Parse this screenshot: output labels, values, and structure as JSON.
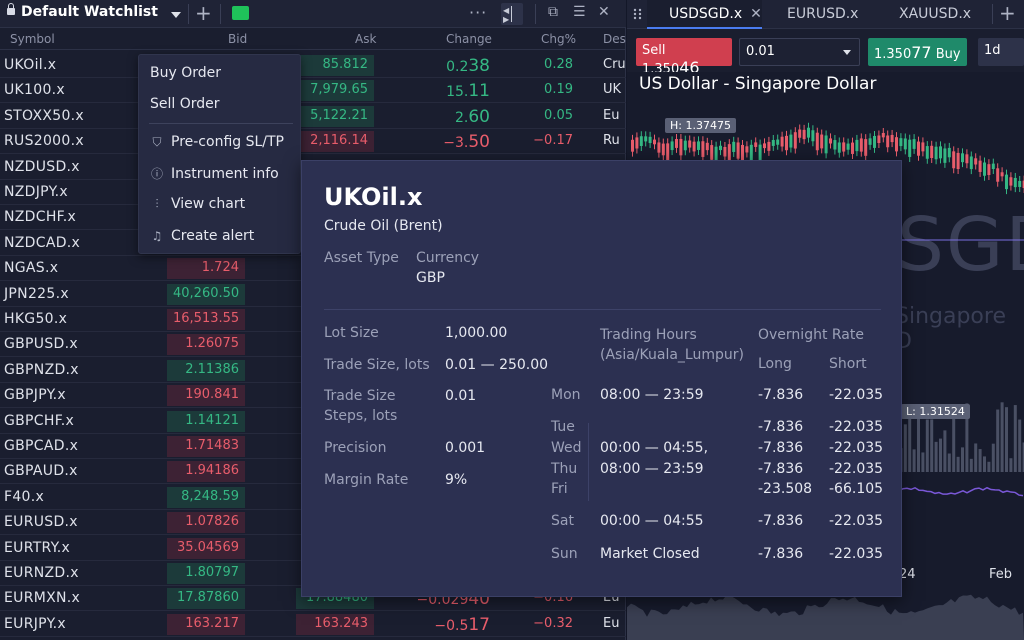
{
  "watchlist": {
    "title": "Default Watchlist",
    "columns": {
      "symbol": "Symbol",
      "bid": "Bid",
      "ask": "Ask",
      "change": "Change",
      "chg_pct": "Chg%",
      "desc": "Des"
    },
    "rows": [
      {
        "symbol": "UKOil.x",
        "bid": "",
        "ask": "85.812",
        "chg_main": "0.2",
        "chg_big": "38",
        "chg_pct": "0.28",
        "desc": "Cru",
        "dir": "up"
      },
      {
        "symbol": "UK100.x",
        "bid": "",
        "ask": "7,979.65",
        "chg_main": "15.",
        "chg_big": "11",
        "chg_pct": "0.19",
        "desc": "UK",
        "dir": "up"
      },
      {
        "symbol": "STOXX50.x",
        "bid": "",
        "ask": "5,122.21",
        "chg_main": "2.",
        "chg_big": "60",
        "chg_pct": "0.05",
        "desc": "Eu",
        "dir": "up"
      },
      {
        "symbol": "RUS2000.x",
        "bid": "",
        "ask": "2,116.14",
        "chg_main": "−3.",
        "chg_big": "50",
        "chg_pct": "−0.17",
        "desc": "Ru",
        "dir": "dn"
      },
      {
        "symbol": "NZDUSD.x",
        "bid": "",
        "ask": "",
        "chg_main": "",
        "chg_big": "",
        "chg_pct": "",
        "desc": "",
        "dir": "up"
      },
      {
        "symbol": "NZDJPY.x",
        "bid": "",
        "ask": "",
        "chg_main": "",
        "chg_big": "",
        "chg_pct": "",
        "desc": "",
        "dir": "up"
      },
      {
        "symbol": "NZDCHF.x",
        "bid": "",
        "ask": "",
        "chg_main": "",
        "chg_big": "",
        "chg_pct": "",
        "desc": "",
        "dir": "up"
      },
      {
        "symbol": "NZDCAD.x",
        "bid": "",
        "ask": "",
        "chg_main": "",
        "chg_big": "",
        "chg_pct": "",
        "desc": "",
        "dir": "up"
      },
      {
        "symbol": "NGAS.x",
        "bid": "1.724",
        "ask": "",
        "chg_main": "",
        "chg_big": "",
        "chg_pct": "",
        "desc": "",
        "dir": "dn"
      },
      {
        "symbol": "JPN225.x",
        "bid": "40,260.50",
        "ask": "",
        "chg_main": "",
        "chg_big": "",
        "chg_pct": "",
        "desc": "",
        "dir": "up"
      },
      {
        "symbol": "HKG50.x",
        "bid": "16,513.55",
        "ask": "",
        "chg_main": "",
        "chg_big": "",
        "chg_pct": "",
        "desc": "",
        "dir": "dn"
      },
      {
        "symbol": "GBPUSD.x",
        "bid": "1.26075",
        "ask": "",
        "chg_main": "",
        "chg_big": "",
        "chg_pct": "",
        "desc": "",
        "dir": "dn"
      },
      {
        "symbol": "GBPNZD.x",
        "bid": "2.11386",
        "ask": "",
        "chg_main": "",
        "chg_big": "",
        "chg_pct": "",
        "desc": "",
        "dir": "up"
      },
      {
        "symbol": "GBPJPY.x",
        "bid": "190.841",
        "ask": "",
        "chg_main": "",
        "chg_big": "",
        "chg_pct": "",
        "desc": "",
        "dir": "dn"
      },
      {
        "symbol": "GBPCHF.x",
        "bid": "1.14121",
        "ask": "",
        "chg_main": "",
        "chg_big": "",
        "chg_pct": "",
        "desc": "",
        "dir": "up"
      },
      {
        "symbol": "GBPCAD.x",
        "bid": "1.71483",
        "ask": "",
        "chg_main": "",
        "chg_big": "",
        "chg_pct": "",
        "desc": "",
        "dir": "dn"
      },
      {
        "symbol": "GBPAUD.x",
        "bid": "1.94186",
        "ask": "",
        "chg_main": "",
        "chg_big": "",
        "chg_pct": "",
        "desc": "",
        "dir": "dn"
      },
      {
        "symbol": "F40.x",
        "bid": "8,248.59",
        "ask": "",
        "chg_main": "",
        "chg_big": "",
        "chg_pct": "",
        "desc": "",
        "dir": "up"
      },
      {
        "symbol": "EURUSD.x",
        "bid": "1.07826",
        "ask": "",
        "chg_main": "",
        "chg_big": "",
        "chg_pct": "",
        "desc": "",
        "dir": "dn"
      },
      {
        "symbol": "EURTRY.x",
        "bid": "35.04569",
        "ask": "",
        "chg_main": "",
        "chg_big": "",
        "chg_pct": "",
        "desc": "",
        "dir": "dn"
      },
      {
        "symbol": "EURNZD.x",
        "bid": "1.80797",
        "ask": "",
        "chg_main": "",
        "chg_big": "",
        "chg_pct": "",
        "desc": "",
        "dir": "up"
      },
      {
        "symbol": "EURMXN.x",
        "bid": "17.87860",
        "ask": "17.88480",
        "chg_main": "−0.029",
        "chg_big": "40",
        "chg_pct": "−0.16",
        "desc": "Eu",
        "dir": "up"
      },
      {
        "symbol": "EURJPY.x",
        "bid": "163.217",
        "ask": "163.243",
        "chg_main": "−0.5",
        "chg_big": "17",
        "chg_pct": "−0.32",
        "desc": "Eu",
        "dir": "dn"
      }
    ]
  },
  "context_menu": {
    "items": [
      {
        "label": "Buy Order",
        "icon": ""
      },
      {
        "label": "Sell Order",
        "icon": ""
      },
      {
        "label": "Pre-config SL/TP",
        "icon": "shield-icon"
      },
      {
        "label": "Instrument info",
        "icon": "info-icon"
      },
      {
        "label": "View chart",
        "icon": "candles-icon"
      },
      {
        "label": "Create alert",
        "icon": "bell-icon"
      }
    ]
  },
  "instrument_info": {
    "symbol": "UKOil.x",
    "name": "Crude Oil (Brent)",
    "asset_type_label": "Asset Type",
    "currency_label": "Currency",
    "currency": "GBP",
    "lot_size_label": "Lot Size",
    "lot_size": "1,000.00",
    "trade_size_label": "Trade Size, lots",
    "trade_size": "0.01 — 250.00",
    "trade_steps_label_1": "Trade Size",
    "trade_steps_label_2": "Steps, lots",
    "trade_steps": "0.01",
    "precision_label": "Precision",
    "precision": "0.001",
    "margin_label": "Margin Rate",
    "margin": "9%",
    "trading_hours_label_1": "Trading Hours",
    "trading_hours_label_2": "(Asia/Kuala_Lumpur)",
    "overnight_label": "Overnight Rate",
    "long_label": "Long",
    "short_label": "Short",
    "days": {
      "mon": "Mon",
      "tue": "Tue",
      "wed": "Wed",
      "thu": "Thu",
      "fri": "Fri",
      "sat": "Sat",
      "sun": "Sun"
    },
    "hours": {
      "mon": "08:00 — 23:59",
      "tuefri_1": "00:00 — 04:55,",
      "tuefri_2": "08:00 — 23:59",
      "sat": "00:00 — 04:55",
      "sun": "Market Closed"
    },
    "rates": {
      "mon": [
        "-7.836",
        "-22.035"
      ],
      "tue": [
        "-7.836",
        "-22.035"
      ],
      "wed": [
        "-7.836",
        "-22.035"
      ],
      "thu": [
        "-7.836",
        "-22.035"
      ],
      "fri": [
        "-23.508",
        "-66.105"
      ],
      "sat": [
        "-7.836",
        "-22.035"
      ],
      "sun": [
        "-7.836",
        "-22.035"
      ]
    }
  },
  "right_panel": {
    "tabs": [
      "USDSGD.x",
      "EURUSD.x",
      "XAUUSD.x"
    ],
    "sell_label": "Sell",
    "sell_price_main": "1.350",
    "sell_price_big": "46",
    "qty": "0.01",
    "buy_price_main": "1.350",
    "buy_price_big": "77",
    "buy_label": "Buy",
    "timeframe": "1d",
    "chart_title": "US Dollar - Singapore Dollar",
    "high_label": "H: 1.37475",
    "low_label": "L: 1.31524",
    "watermark_big": "SGD",
    "watermark_small": "Singapore D",
    "x_label_1": "24",
    "x_label_2": "Feb"
  },
  "colors": {
    "up": "#35b884",
    "down": "#e85d6b",
    "accent": "#4a7cf0",
    "green_tag": "#1fc25a"
  }
}
